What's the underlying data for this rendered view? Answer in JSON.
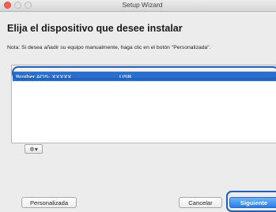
{
  "window": {
    "title": "Setup Wizard"
  },
  "heading": "Elija el dispositivo que desee instalar",
  "note": "Nota: Si desea añadir su equipo manualmente, haga clic en el botón \"Personalizada\".",
  "device_list": {
    "rows": [
      {
        "name": "Brother ADS- XXXXX",
        "connection": "USB"
      }
    ]
  },
  "action_menu": {
    "icon": "gear-icon",
    "glyph": "✲▾"
  },
  "buttons": {
    "custom": "Personalizada",
    "cancel": "Cancelar",
    "next": "Siguiente"
  },
  "colors": {
    "selection": "#2a6fce",
    "focus_ring": "#1f5fb5",
    "close": "#fc5f57"
  }
}
